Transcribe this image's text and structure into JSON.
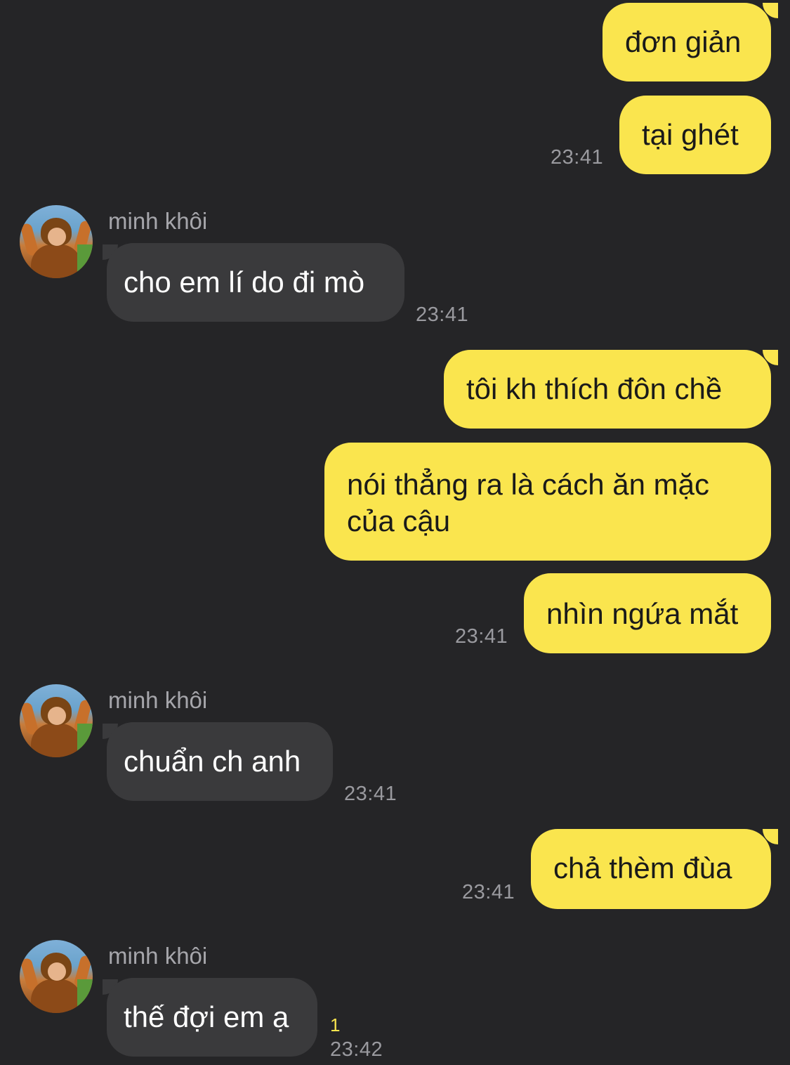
{
  "contact": {
    "name": "minh khôi"
  },
  "colors": {
    "background": "#252527",
    "my_bubble": "#fae54e",
    "their_bubble": "#3a3a3c",
    "timestamp": "#9a9a9f",
    "unread": "#fae54e"
  },
  "messages": [
    {
      "from": "me",
      "text": "đơn giản"
    },
    {
      "from": "me",
      "text": "tại ghét",
      "time": "23:41"
    },
    {
      "from": "them",
      "sender": "minh khôi",
      "text": "cho em lí do đi mò",
      "time": "23:41"
    },
    {
      "from": "me",
      "text": "tôi kh thích đôn chề"
    },
    {
      "from": "me",
      "text": "nói thẳng ra là cách ăn mặc\ncủa cậu"
    },
    {
      "from": "me",
      "text": "nhìn ngứa mắt",
      "time": "23:41"
    },
    {
      "from": "them",
      "sender": "minh khôi",
      "text": "chuẩn ch anh",
      "time": "23:41"
    },
    {
      "from": "me",
      "text": "chả thèm đùa",
      "time": "23:41"
    },
    {
      "from": "them",
      "sender": "minh khôi",
      "text": "thế đợi em ạ",
      "time": "23:42",
      "unread": "1"
    }
  ]
}
